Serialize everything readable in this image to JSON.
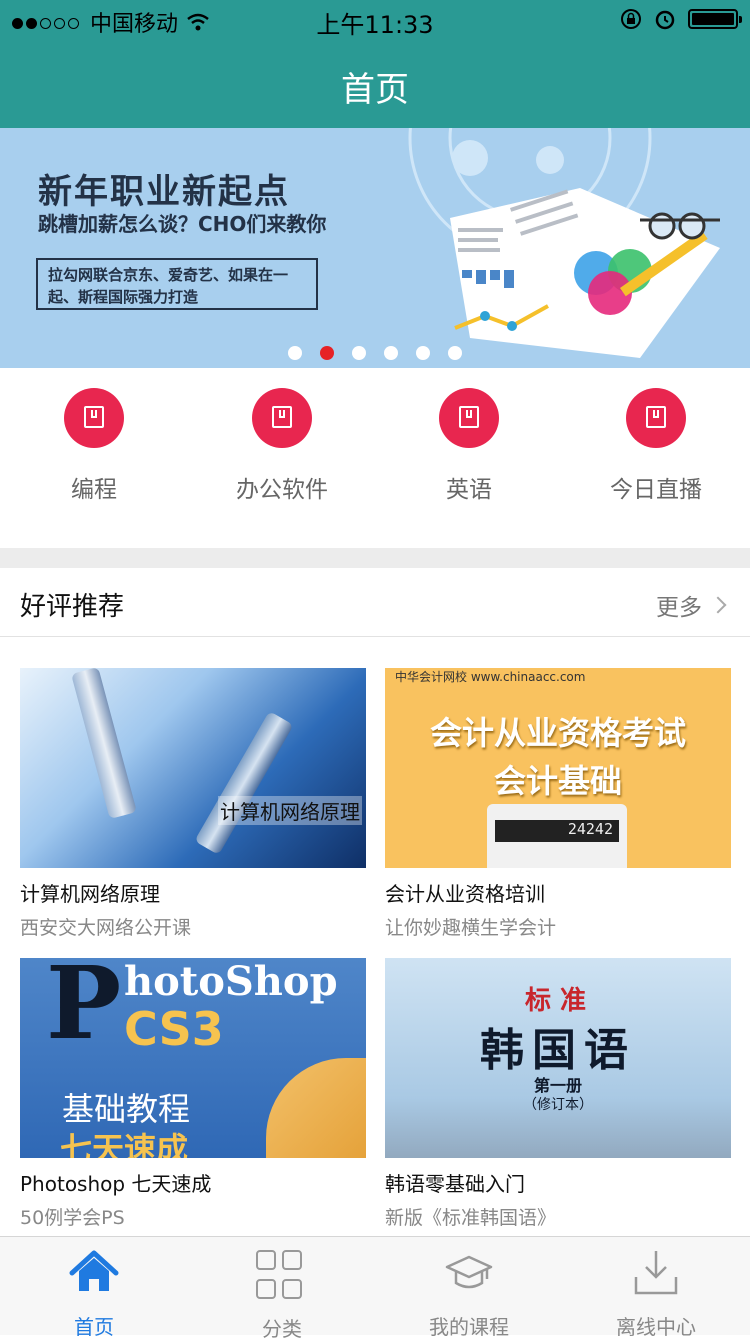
{
  "status_bar": {
    "carrier": "中国移动",
    "time": "上午11:33"
  },
  "nav": {
    "title": "首页"
  },
  "banner": {
    "headline": "新年职业新起点",
    "subhead": "跳槽加薪怎么谈？CHO们来教你",
    "box_text": "拉勾网联合京东、爱奇艺、如果在一起、斯程国际强力打造",
    "page_count": 6,
    "active_page": 2
  },
  "categories": [
    {
      "label": "编程",
      "icon": "bookmark-icon"
    },
    {
      "label": "办公软件",
      "icon": "bookmark-icon"
    },
    {
      "label": "英语",
      "icon": "bookmark-icon"
    },
    {
      "label": "今日直播",
      "icon": "bookmark-icon"
    }
  ],
  "section": {
    "title": "好评推荐",
    "more": "更多"
  },
  "courses": [
    {
      "name": "计算机网络原理",
      "subtitle": "西安交大网络公开课",
      "image_text": "计算机网络原理"
    },
    {
      "name": "会计从业资格培训",
      "subtitle": "让你妙趣横生学会计",
      "image_logo": "中华会计网校 www.chinaacc.com",
      "image_line1": "会计从业资格考试",
      "image_line2": "会计基础",
      "image_display": "24242"
    },
    {
      "name": "Photoshop 七天速成",
      "subtitle": "50例学会PS",
      "image_p": "P",
      "image_hoto": "hotoShop",
      "image_cs3": "CS3",
      "image_jc": "基础教程",
      "image_qt": "七天速成"
    },
    {
      "name": "韩语零基础入门",
      "subtitle": "新版《标准韩国语》",
      "image_bz": "标 准",
      "image_hgy": "韩国语",
      "image_dyc": "第一册",
      "image_xdb": "（修订本）"
    }
  ],
  "tabs": [
    {
      "label": "首页",
      "icon": "home-icon",
      "active": true
    },
    {
      "label": "分类",
      "icon": "grid-icon",
      "active": false
    },
    {
      "label": "我的课程",
      "icon": "graduation-cap-icon",
      "active": false
    },
    {
      "label": "离线中心",
      "icon": "download-icon",
      "active": false
    }
  ],
  "colors": {
    "header": "#2a9a94",
    "category_circle": "#e8264f",
    "tab_active": "#1f7ae0",
    "pager_active": "#e62226"
  }
}
